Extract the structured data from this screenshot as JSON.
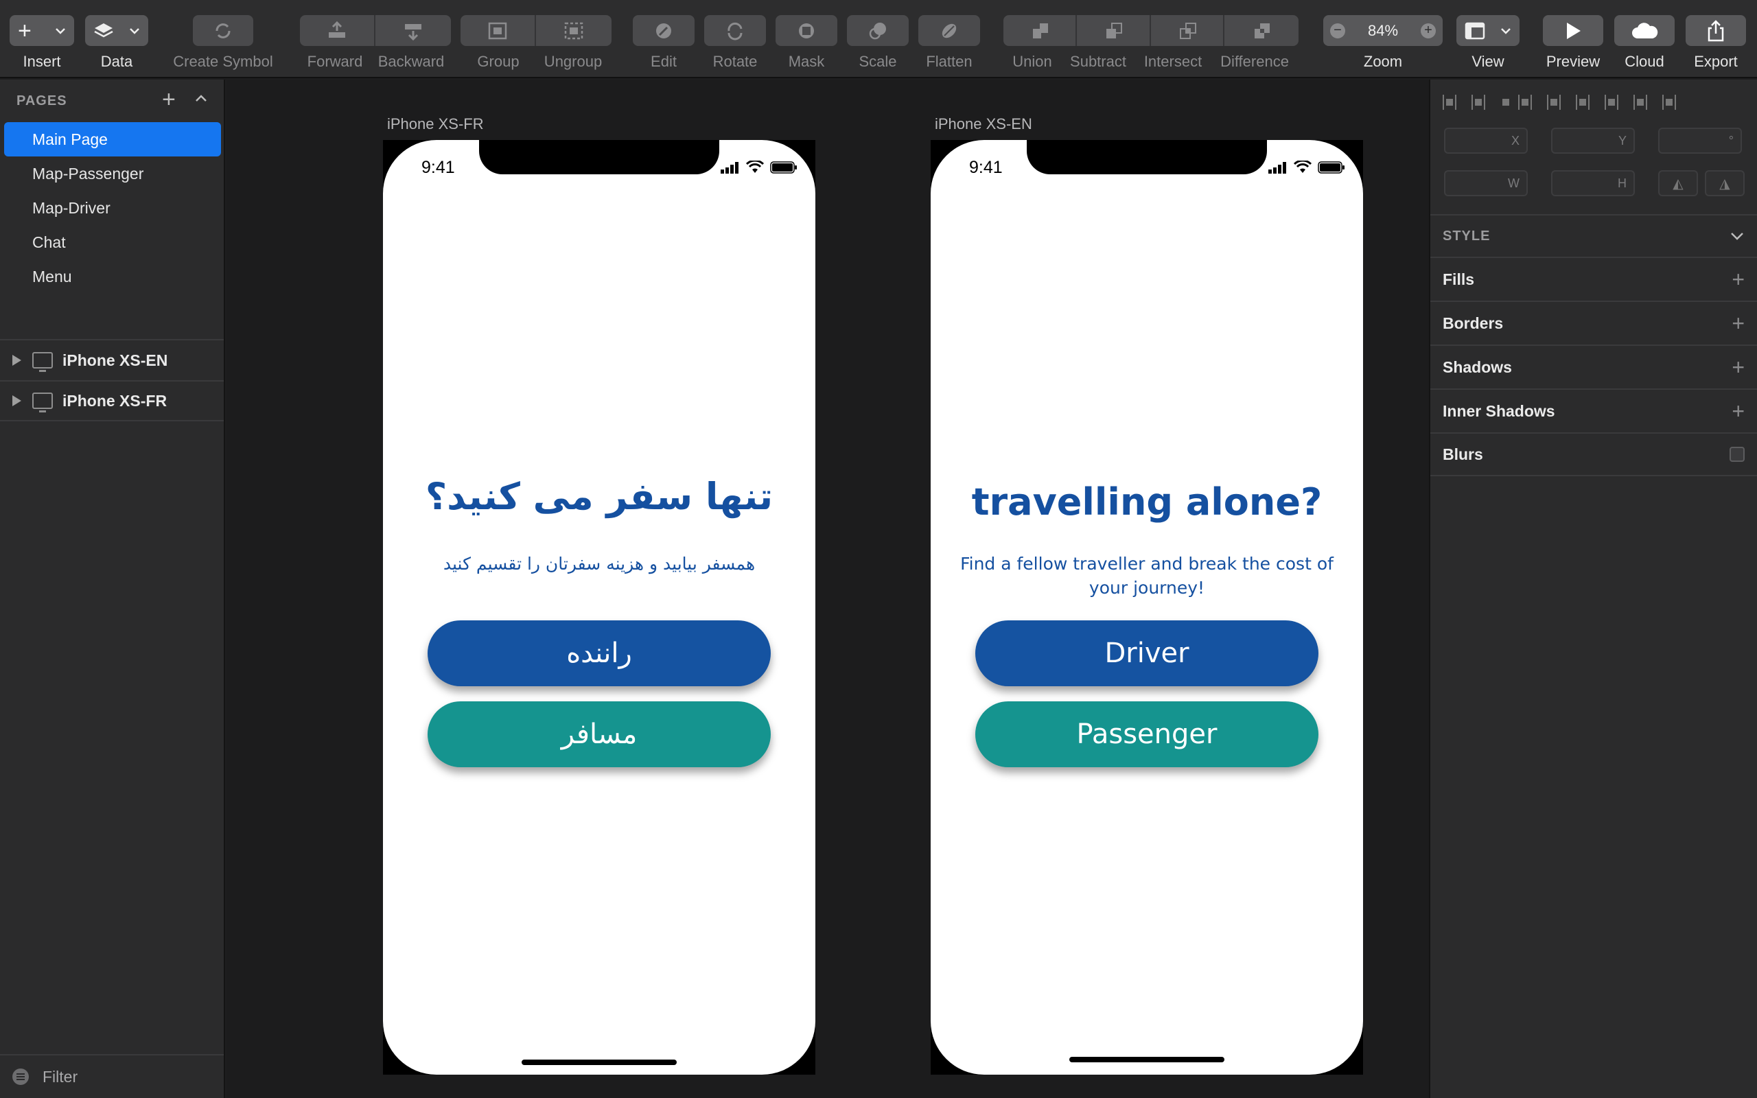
{
  "toolbar": {
    "insert": "Insert",
    "data": "Data",
    "create_symbol": "Create Symbol",
    "forward": "Forward",
    "backward": "Backward",
    "group": "Group",
    "ungroup": "Ungroup",
    "edit": "Edit",
    "rotate": "Rotate",
    "mask": "Mask",
    "scale": "Scale",
    "flatten": "Flatten",
    "union": "Union",
    "subtract": "Subtract",
    "intersect": "Intersect",
    "difference": "Difference",
    "zoom_label": "Zoom",
    "zoom_value": "84%",
    "view": "View",
    "preview": "Preview",
    "cloud": "Cloud",
    "export": "Export"
  },
  "sidebar": {
    "pages_header": "PAGES",
    "pages": [
      {
        "label": "Main Page",
        "active": true
      },
      {
        "label": "Map-Passenger"
      },
      {
        "label": "Map-Driver"
      },
      {
        "label": "Chat"
      },
      {
        "label": "Menu"
      }
    ],
    "layers": [
      {
        "label": "iPhone XS-EN"
      },
      {
        "label": "iPhone XS-FR"
      }
    ],
    "filter": "Filter"
  },
  "canvas": {
    "artboards": [
      {
        "label": "iPhone XS-FR",
        "time": "9:41",
        "title": "تنها سفر می کنید؟",
        "subtitle": "همسفر بیابید و هزینه سفرتان را تقسیم کنید",
        "driver_button": "راننده",
        "passenger_button": "مسافر"
      },
      {
        "label": "iPhone XS-EN",
        "time": "9:41",
        "title": "travelling alone?",
        "subtitle": "Find a fellow traveller and break the cost of your journey!",
        "driver_button": "Driver",
        "passenger_button": "Passenger"
      }
    ],
    "colors": {
      "driver": "#1553a1",
      "passenger": "#15948f",
      "title": "#1550a0"
    }
  },
  "inspector": {
    "x": "X",
    "y": "Y",
    "rotation": "°",
    "w": "W",
    "h": "H",
    "style_header": "STYLE",
    "sections": [
      "Fills",
      "Borders",
      "Shadows",
      "Inner Shadows",
      "Blurs"
    ]
  },
  "icons": {
    "insert": "plus-icon",
    "data": "layers-icon",
    "preview": "play-icon",
    "cloud": "cloud-icon",
    "export": "share-icon"
  }
}
